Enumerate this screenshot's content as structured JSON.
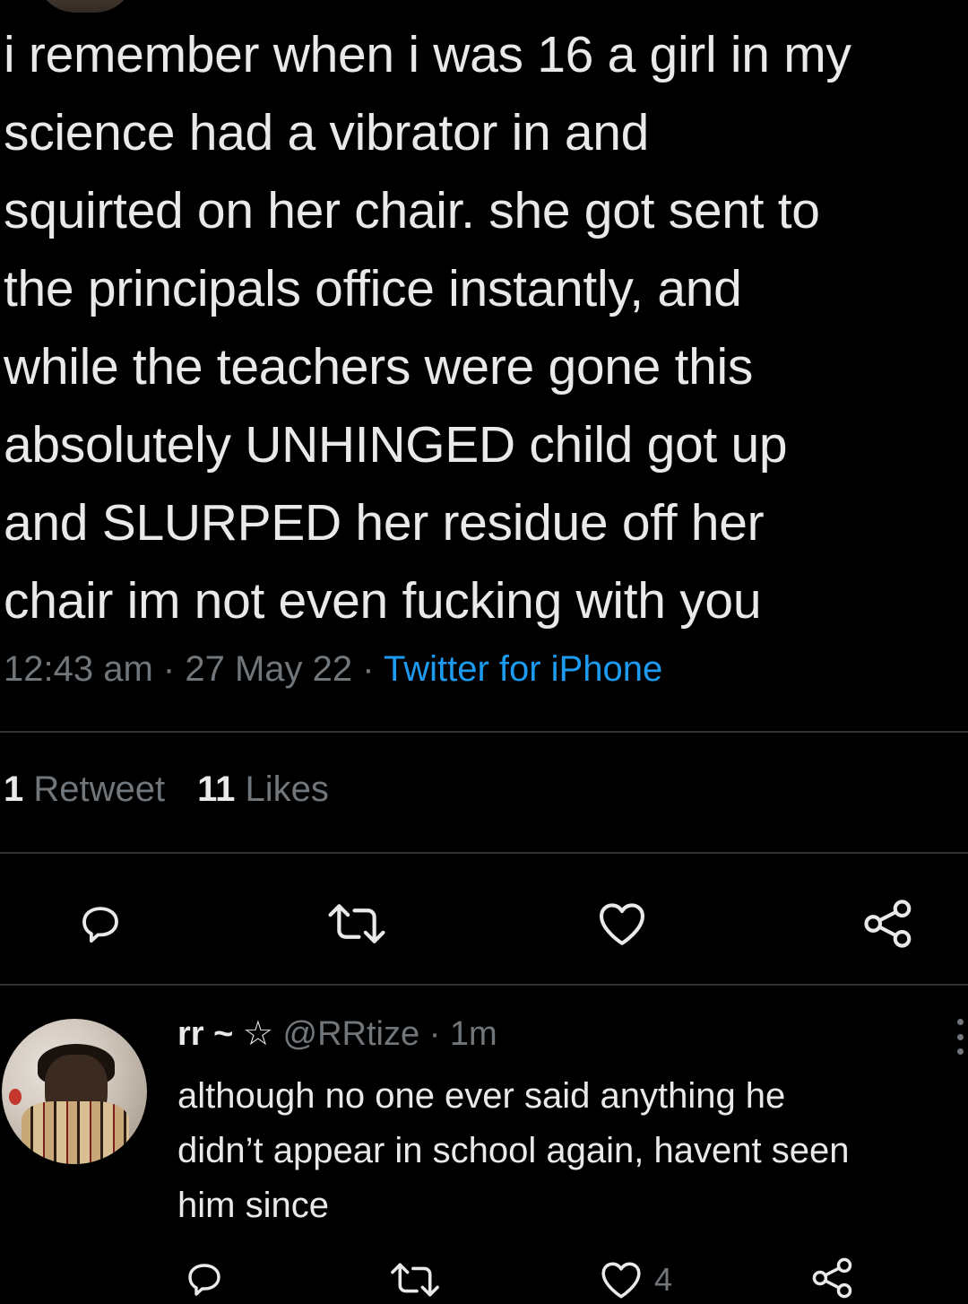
{
  "tweet": {
    "text": "i remember when i was 16 a girl in my\nscience had a vibrator in and\nsquirted on her chair. she got sent to\nthe principals office instantly, and\nwhile the teachers were gone this\nabsolutely UNHINGED child got up\nand SLURPED her residue off her\nchair im not even fucking with you",
    "time": "12:43 am",
    "date": "27 May 22",
    "separator": "·",
    "source": "Twitter for iPhone"
  },
  "stats": {
    "retweets_count": "1",
    "retweets_label": "Retweet",
    "likes_count": "11",
    "likes_label": "Likes"
  },
  "actions": {
    "reply_icon": "reply-icon",
    "retweet_icon": "retweet-icon",
    "like_icon": "heart-icon",
    "share_icon": "share-icon"
  },
  "reply": {
    "display_name": "rr ~",
    "star": "☆",
    "handle": "@RRtize",
    "separator": "·",
    "age": "1m",
    "text": "although no one ever said anything he\ndidn’t appear in school again, havent seen\nhim since",
    "like_count": "4"
  },
  "colors": {
    "background": "#000000",
    "text": "#e7e9ea",
    "muted": "#71767b",
    "link": "#1d9bf0",
    "divider": "#2f3336"
  }
}
